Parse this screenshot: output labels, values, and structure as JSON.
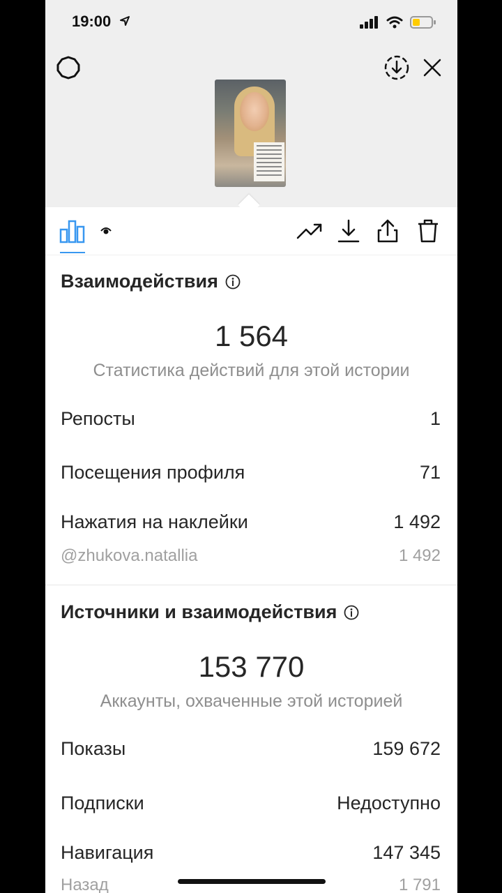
{
  "status_bar": {
    "time": "19:00"
  },
  "interactions": {
    "title": "Взаимодействия",
    "total": "1 564",
    "caption": "Статистика действий для этой истории",
    "rows": [
      {
        "label": "Репосты",
        "value": "1"
      },
      {
        "label": "Посещения профиля",
        "value": "71"
      },
      {
        "label": "Нажатия на наклейки",
        "value": "1 492"
      }
    ],
    "sub_row": {
      "label": "@zhukova.natallia",
      "value": "1 492"
    }
  },
  "discovery": {
    "title": "Источники и взаимодействия",
    "total": "153 770",
    "caption": "Аккаунты, охваченные этой историей",
    "rows": [
      {
        "label": "Показы",
        "value": "159 672"
      },
      {
        "label": "Подписки",
        "value": "Недоступно"
      },
      {
        "label": "Навигация",
        "value": "147 345"
      }
    ],
    "sub_row": {
      "label": "Назад",
      "value": "1 791"
    }
  },
  "colors": {
    "accent": "#3897f0",
    "text": "#262626",
    "muted": "#8e8e8e"
  },
  "icons": [
    "settings-icon",
    "download-circle-icon",
    "close-icon",
    "insights-icon",
    "eye-icon",
    "promote-icon",
    "download-icon",
    "share-icon",
    "trash-icon",
    "info-icon"
  ]
}
